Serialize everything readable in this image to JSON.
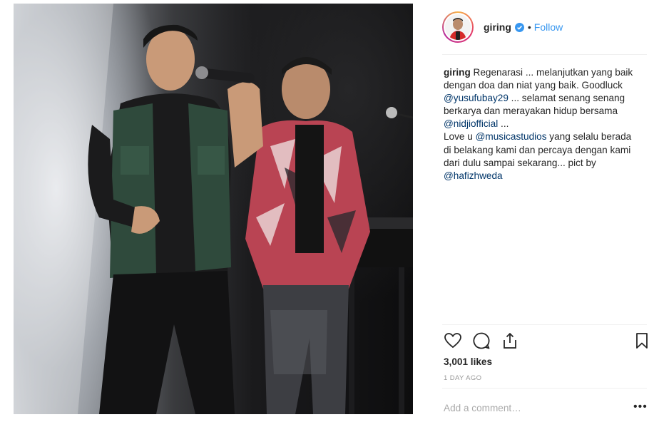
{
  "post": {
    "username": "giring",
    "follow_label": "Follow",
    "separator": "•"
  },
  "caption": {
    "username": "giring",
    "text1": " Regenarasi ... melanjutkan yang baik dengan doa dan niat yang baik. Goodluck ",
    "mention1": "@yusufubay29",
    "text2": " ... selamat senang senang berkarya dan merayakan hidup bersama ",
    "mention2": "@nidjiofficial",
    "text3": " ...",
    "text4": "Love u ",
    "mention3": "@musicastudios",
    "text5": " yang selalu berada di belakang kami dan percaya dengan kami dari dulu sampai sekarang... pict by ",
    "mention4": "@hafizhweda"
  },
  "stats": {
    "likes": "3,001 likes",
    "time": "1 DAY AGO"
  },
  "comment": {
    "placeholder": "Add a comment…",
    "more": "•••"
  },
  "colors": {
    "link": "#3897f0",
    "mention": "#003569",
    "muted": "#999999"
  },
  "icons": [
    "verified-icon",
    "heart-icon",
    "comment-icon",
    "share-icon",
    "bookmark-icon",
    "more-icon"
  ]
}
